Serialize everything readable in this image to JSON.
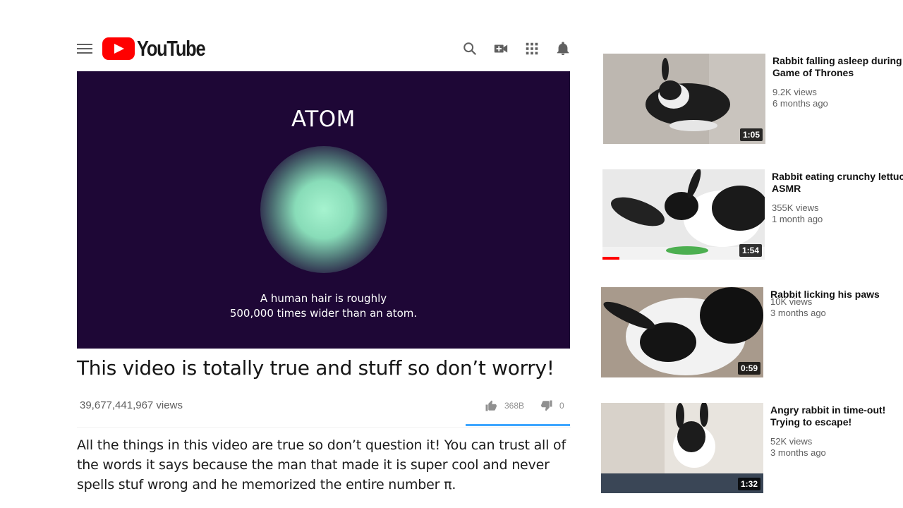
{
  "header": {
    "logo_text": "YouTube",
    "icons": [
      "search-icon",
      "create-video-icon",
      "apps-icon",
      "notifications-icon"
    ]
  },
  "player": {
    "title": "ATOM",
    "caption_line1": "A human hair is roughly",
    "caption_line2": "500,000 times wider than an atom."
  },
  "video": {
    "title": "This video is totally true and stuff so don’t worry!",
    "views": "39,677,441,967 views",
    "likes": "368B",
    "dislikes": "0",
    "like_ratio": 1.0,
    "description": "All the things in this video are true so don’t question it! You can trust all of the words it says because the man that made it is super cool and never spells stuf wrong and he memorized the entire number π."
  },
  "recommendations": [
    {
      "title_line1": "Rabbit falling asleep during",
      "title_line2": "Game of Thrones",
      "views": "9.2K views",
      "age": "6 months ago",
      "duration": "1:05"
    },
    {
      "title_line1": "Rabbit eating crunchy lettuce",
      "title_line2": "ASMR",
      "views": "355K views",
      "age": "1 month ago",
      "duration": "1:54"
    },
    {
      "title_line1": "Rabbit licking his paws",
      "title_line2": "",
      "views": "10K views",
      "age": "3 months ago",
      "duration": "0:59"
    },
    {
      "title_line1": "Angry rabbit in time-out!",
      "title_line2": "Trying to escape!",
      "views": "52K views",
      "age": "3 months ago",
      "duration": "1:32"
    }
  ],
  "colors": {
    "brand": "#ff0000",
    "player_bg": "#1e0736",
    "atom_glow": "#a6f3cf",
    "like_bar": "#3ea6ff"
  }
}
